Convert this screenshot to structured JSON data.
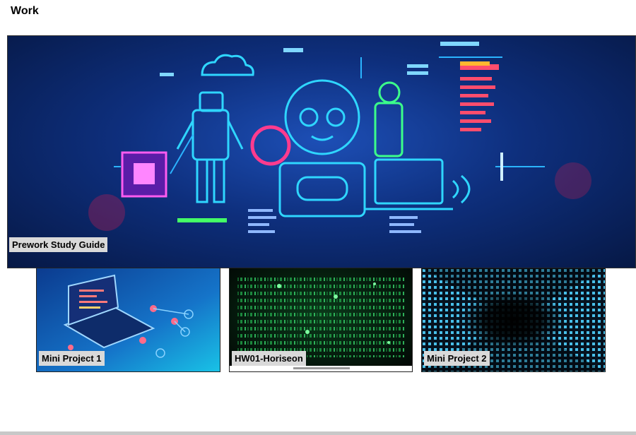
{
  "section": {
    "title": "Work"
  },
  "projects": {
    "featured": {
      "label": "Prework Study Guide"
    },
    "items": [
      {
        "label": "Mini Project 1"
      },
      {
        "label": "HW01-Horiseon"
      },
      {
        "label": "Mini Project 2"
      }
    ]
  },
  "colors": {
    "caption_bg": "#d9d9d9",
    "footer_bar": "#c8c8c8"
  }
}
